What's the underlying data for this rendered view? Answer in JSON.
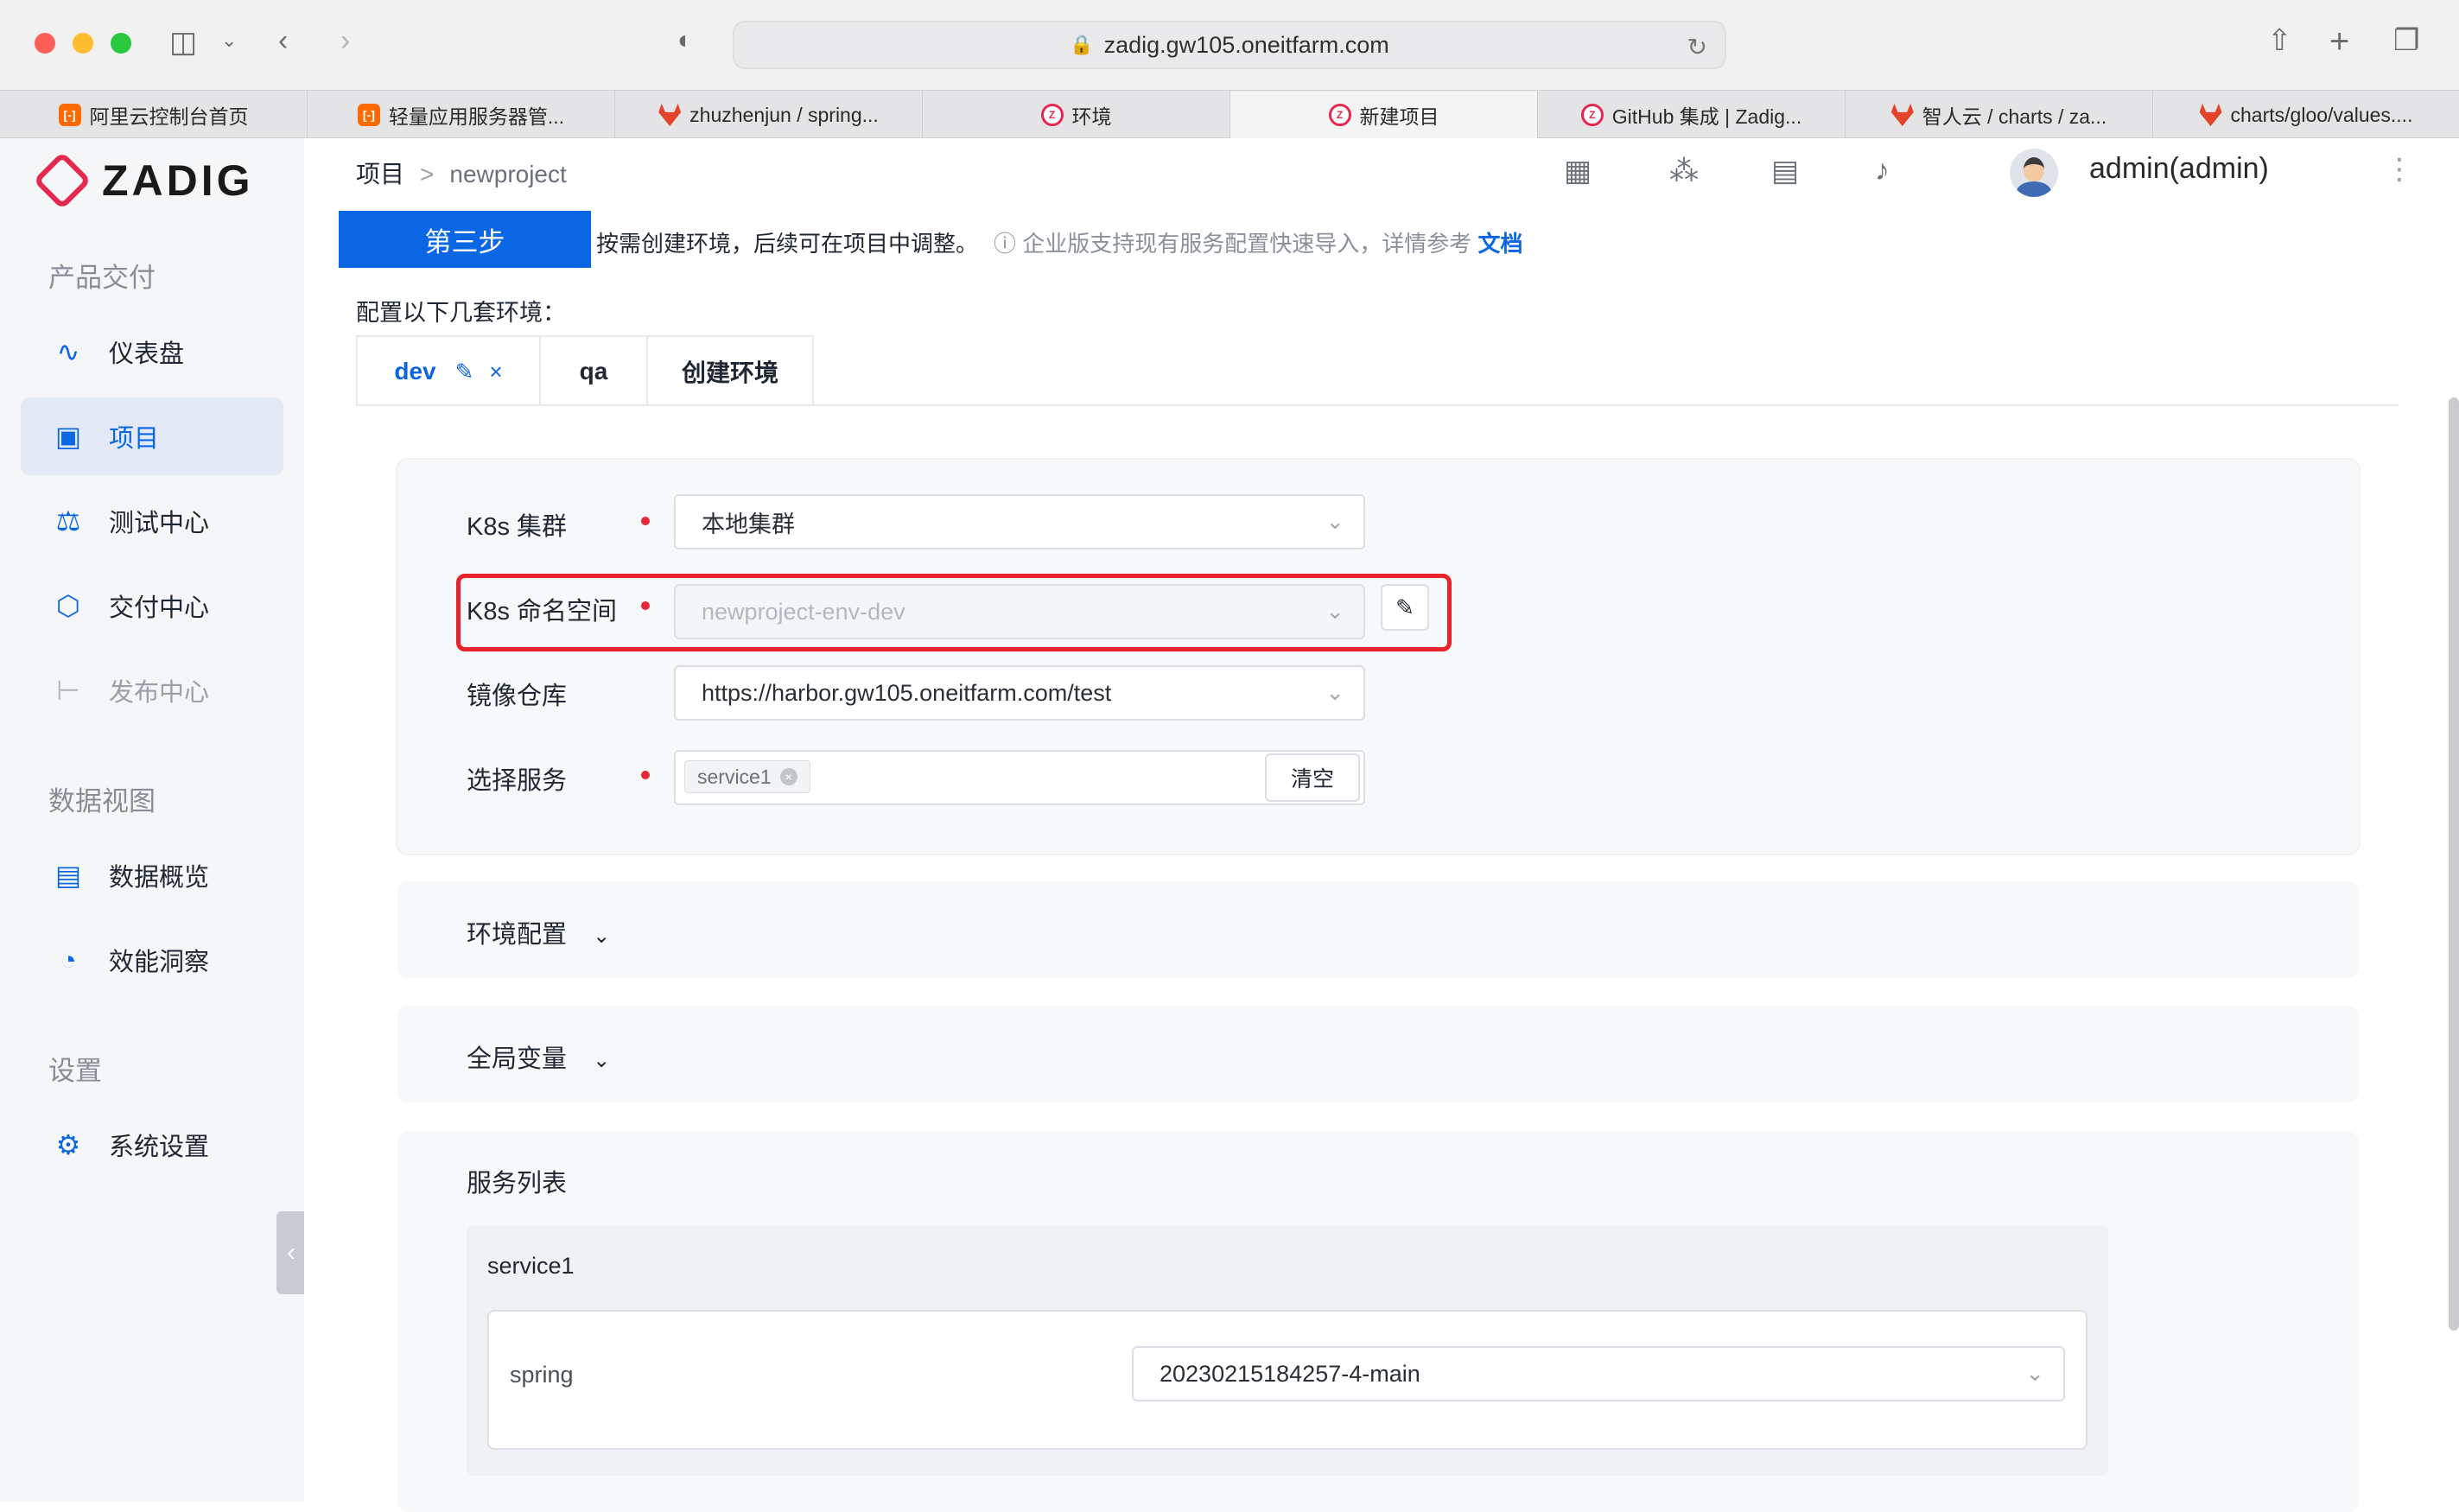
{
  "browser": {
    "url": "zadig.gw105.oneitfarm.com",
    "tabs": [
      {
        "label": "阿里云控制台首页",
        "favicon": "aliyun-icon"
      },
      {
        "label": "轻量应用服务器管...",
        "favicon": "aliyun-icon"
      },
      {
        "label": "zhuzhenjun / spring...",
        "favicon": "gitlab-icon"
      },
      {
        "label": "环境",
        "favicon": "zadig-icon"
      },
      {
        "label": "新建项目",
        "favicon": "zadig-icon",
        "active": true
      },
      {
        "label": "GitHub 集成 | Zadig...",
        "favicon": "zadig-icon"
      },
      {
        "label": "智人云 / charts / za...",
        "favicon": "gitlab-icon"
      },
      {
        "label": "charts/gloo/values....",
        "favicon": "gitlab-icon"
      }
    ]
  },
  "sidebar": {
    "brand": "ZADIG",
    "sections": [
      {
        "title": "产品交付",
        "items": [
          {
            "label": "仪表盘",
            "icon": "dashboard-icon"
          },
          {
            "label": "项目",
            "icon": "project-icon",
            "active": true
          },
          {
            "label": "测试中心",
            "icon": "flask-icon"
          },
          {
            "label": "交付中心",
            "icon": "package-icon"
          },
          {
            "label": "发布中心",
            "icon": "tree-icon",
            "disabled": true
          }
        ]
      },
      {
        "title": "数据视图",
        "items": [
          {
            "label": "数据概览",
            "icon": "monitor-chart-icon"
          },
          {
            "label": "效能洞察",
            "icon": "pie-chart-icon"
          }
        ]
      },
      {
        "title": "设置",
        "items": [
          {
            "label": "系统设置",
            "icon": "gear-icon"
          }
        ]
      }
    ]
  },
  "header": {
    "breadcrumb_root": "项目",
    "breadcrumb_sep": ">",
    "breadcrumb_current": "newproject",
    "username": "admin(admin)"
  },
  "step": {
    "badge": "第三步",
    "desc": "按需创建环境，后续可在项目中调整。",
    "hint": "企业版支持现有服务配置快速导入，详情参考",
    "link": "文档"
  },
  "env": {
    "label": "配置以下几套环境：",
    "tabs": [
      "dev",
      "qa",
      "创建环境"
    ]
  },
  "form": {
    "cluster_label": "K8s 集群",
    "cluster_value": "本地集群",
    "namespace_label": "K8s 命名空间",
    "namespace_value": "newproject-env-dev",
    "registry_label": "镜像仓库",
    "registry_value": "https://harbor.gw105.oneitfarm.com/test",
    "service_label": "选择服务",
    "service_chip": "service1",
    "clear_label": "清空"
  },
  "sections": {
    "env_config": "环境配置",
    "global_vars": "全局变量",
    "service_list": "服务列表"
  },
  "service": {
    "name": "service1",
    "container": "spring",
    "image": "20230215184257-4-main"
  },
  "colors": {
    "primary": "#0b66e4",
    "brand": "#e5284d",
    "highlight": "#e8232b",
    "required": "#e5283a"
  }
}
